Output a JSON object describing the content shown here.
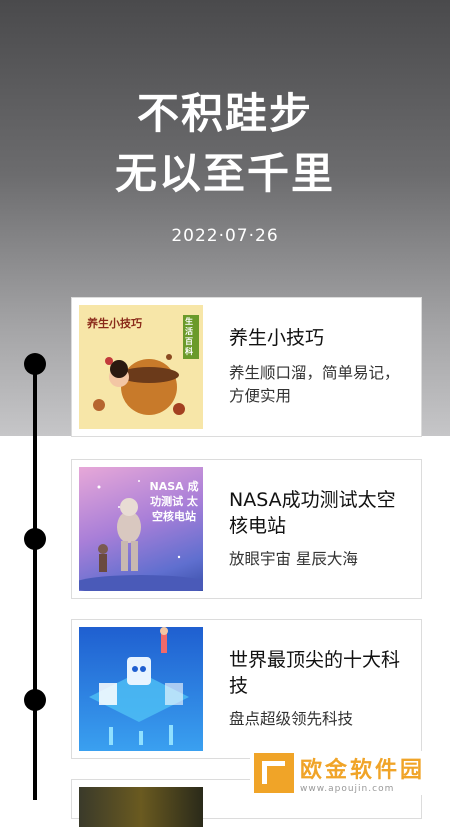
{
  "hero": {
    "line1": "不积跬步",
    "line2": "无以至千里",
    "date": "2022·07·26"
  },
  "cards": [
    {
      "title": "养生小技巧",
      "subtitle": "养生顺口溜，简单易记，方便实用",
      "thumb_label": "养生小技巧",
      "thumb_tag": "生活百科"
    },
    {
      "title": "NASA成功测试太空核电站",
      "subtitle": "放眼宇宙 星辰大海",
      "thumb_label": "NASA 成功测试 太空核电站"
    },
    {
      "title": "世界最顶尖的十大科技",
      "subtitle": "盘点超级领先科技"
    }
  ],
  "watermark": {
    "name": "欧金软件园",
    "url": "www.apoujin.com"
  },
  "colors": {
    "timeline": "#000000",
    "brand": "#f0a428"
  }
}
